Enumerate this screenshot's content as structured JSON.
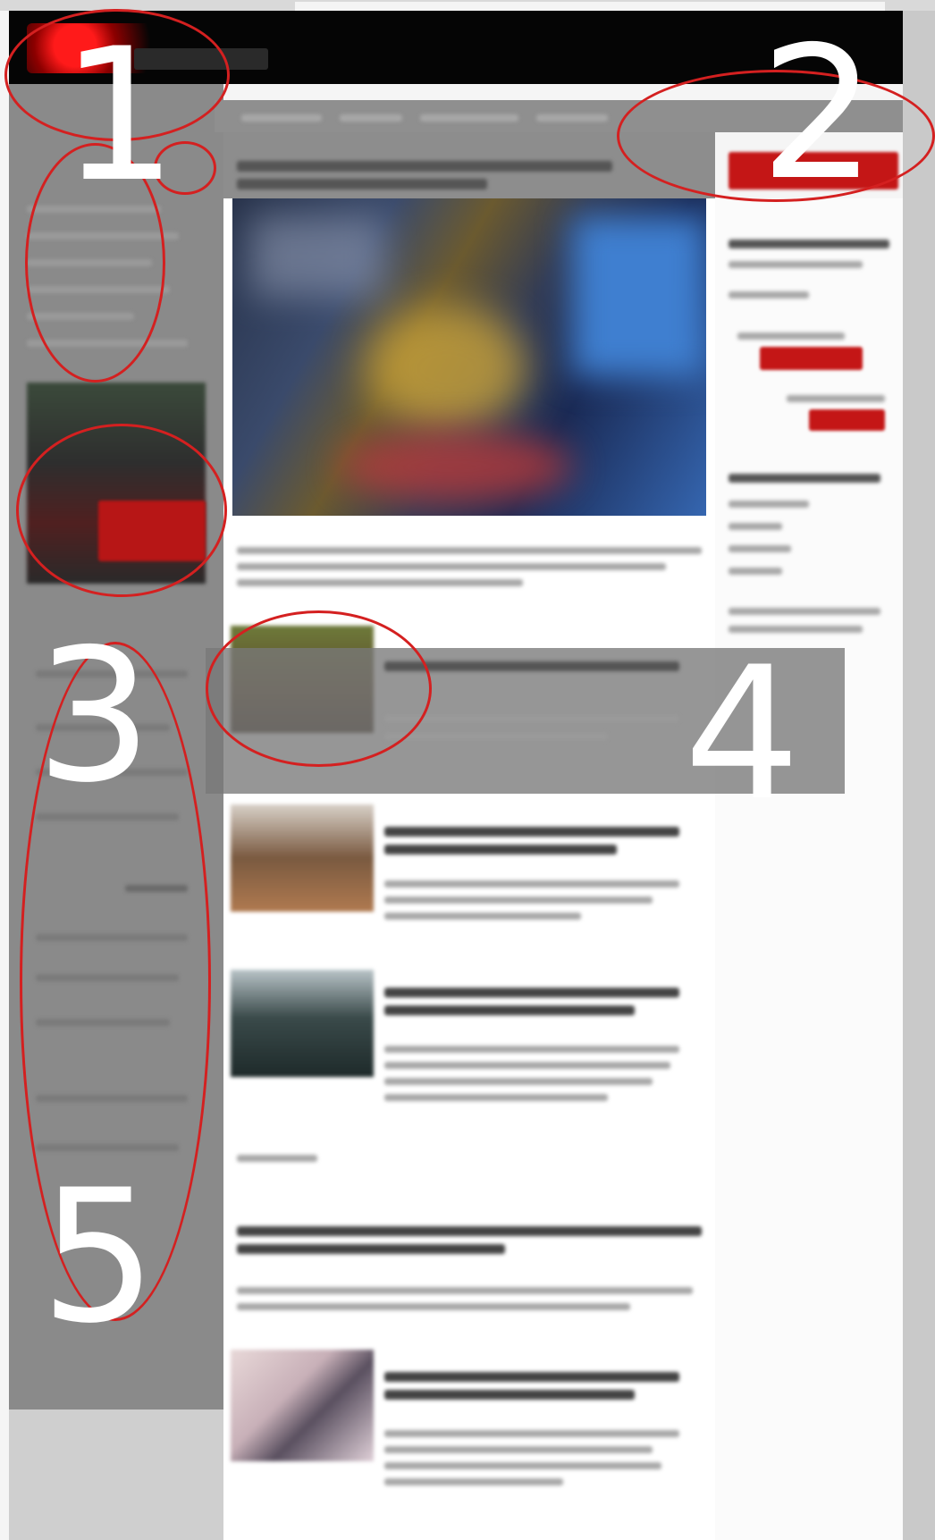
{
  "annotations": {
    "labels": [
      "1",
      "2",
      "3",
      "4",
      "5"
    ]
  },
  "header": {
    "nav_button_label": ""
  },
  "colors": {
    "header_bg": "#050505",
    "accent_red": "#c41616",
    "overlay_grey": "#8a8a8a",
    "annotation_ellipse": "#d42020"
  }
}
